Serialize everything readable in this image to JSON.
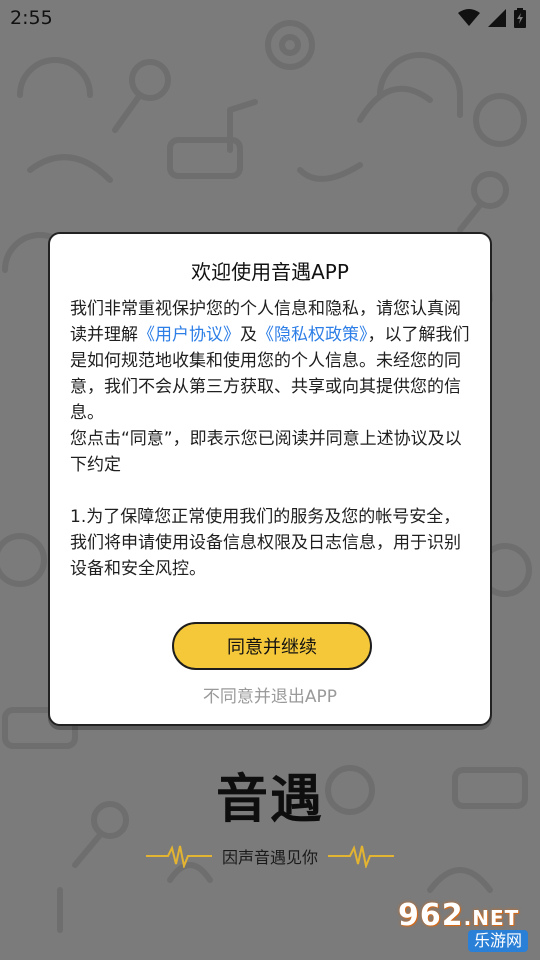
{
  "status_bar": {
    "time": "2:55",
    "icons": [
      "wifi-icon",
      "signal-icon",
      "battery-charging-icon"
    ]
  },
  "dialog": {
    "title": "欢迎使用音遇APP",
    "body_part1": "我们非常重视保护您的个人信息和隐私，请您认真阅读并理解",
    "user_agreement_link": "《用户协议》",
    "and": "及",
    "privacy_policy_link": "《隐私权政策》",
    "body_part2": "，以了解我们是如何规范地收集和使用您的个人信息。未经您的同意，我们不会从第三方获取、共享或向其提供您的信息。",
    "consent_note": "您点击“同意”，即表示您已阅读并同意上述协议及以下约定",
    "clause_1": "1.为了保障您正常使用我们的服务及您的帐号安全，我们将申请使用设备信息权限及日志信息，用于识别设备和安全风控。",
    "agree_button": "同意并继续",
    "disagree_link": "不同意并退出APP"
  },
  "brand": {
    "name": "音遇",
    "slogan": "因声音遇见你"
  },
  "watermark": {
    "top": "962",
    "top_suffix": ".NET",
    "bottom": "乐游网"
  },
  "colors": {
    "background": "#7b7b7b",
    "agree_button": "#f5c83a",
    "link": "#2d7ee6",
    "disagree_text": "#9a9a9a"
  }
}
